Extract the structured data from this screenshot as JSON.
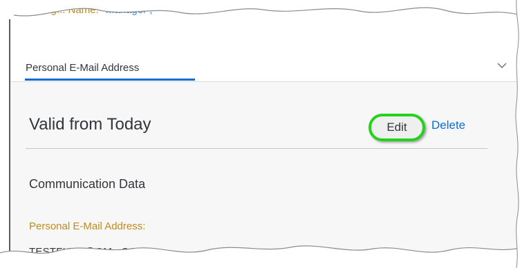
{
  "header": {
    "manager_label": "Manag... Name:",
    "manager_value": "Manager ,"
  },
  "tabs": [
    {
      "label": "Personal E-Mail Address",
      "selected": true
    }
  ],
  "section": {
    "title": "Valid from Today",
    "edit_label": "Edit",
    "delete_label": "Delete"
  },
  "communication": {
    "heading": "Communication Data",
    "email_label": "Personal E-Mail Address:",
    "email_value": "TESTFIORI@GM...COM"
  },
  "colors": {
    "accent": "#0a6ed1",
    "label_gold": "#c28b19",
    "highlight_green": "#23d21b",
    "text": "#32363a"
  },
  "icons": {
    "tab_chevron": "chevron-down-icon"
  }
}
